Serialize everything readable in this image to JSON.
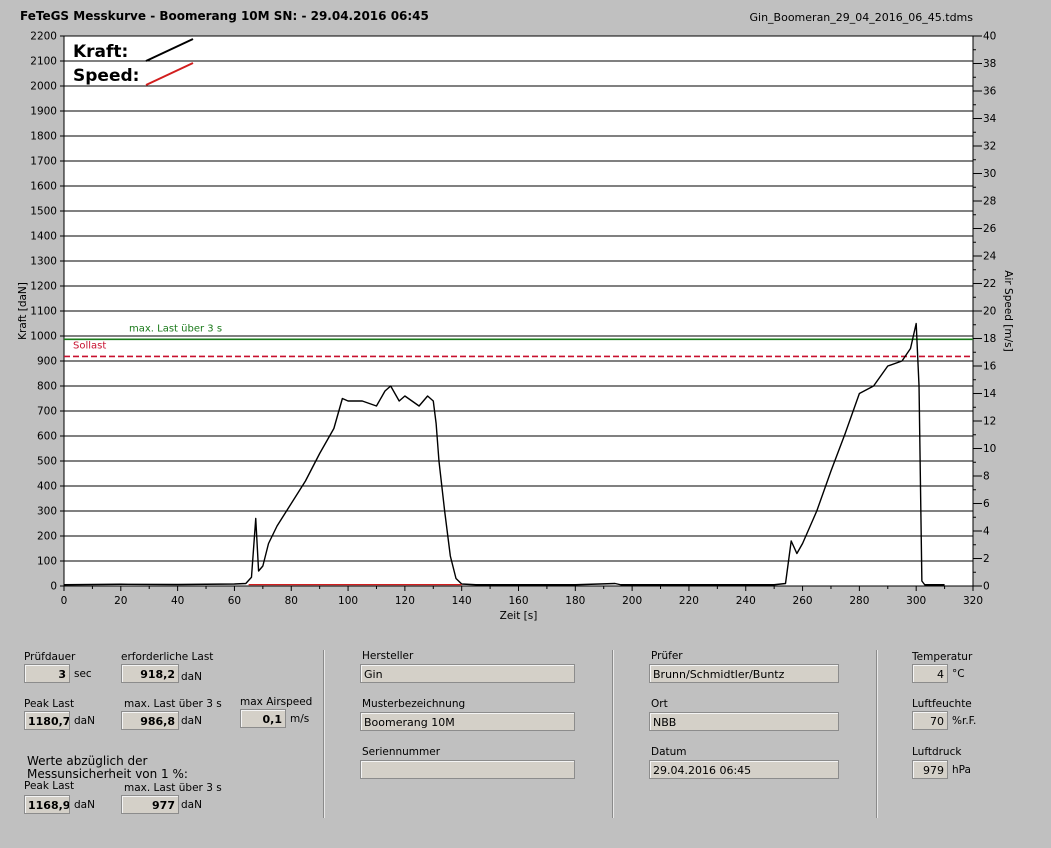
{
  "header": {
    "title": "FeTeGS Messkurve - Boomerang 10M  SN:  - 29.04.2016 06:45",
    "filename": "Gin_Boomeran_29_04_2016_06_45.tdms"
  },
  "chart_data": {
    "type": "line",
    "xlabel": "Zeit [s]",
    "ylabel": "Kraft [daN]",
    "y2label": "Air Speed [m/s]",
    "xlim": [
      0,
      320
    ],
    "ylim": [
      0,
      2200
    ],
    "y2lim": [
      0,
      40
    ],
    "xticks": [
      0,
      20,
      40,
      60,
      80,
      100,
      120,
      140,
      160,
      180,
      200,
      220,
      240,
      260,
      280,
      300,
      320
    ],
    "yticks": [
      0,
      100,
      200,
      300,
      400,
      500,
      600,
      700,
      800,
      900,
      1000,
      1100,
      1200,
      1300,
      1400,
      1500,
      1600,
      1700,
      1800,
      1900,
      2000,
      2100,
      2200
    ],
    "y2ticks": [
      0,
      2,
      4,
      6,
      8,
      10,
      12,
      14,
      16,
      18,
      20,
      22,
      24,
      26,
      28,
      30,
      32,
      34,
      36,
      38,
      40
    ],
    "grid": "horizontal",
    "legend": [
      {
        "name": "Kraft:",
        "color": "#000000"
      },
      {
        "name": "Speed:",
        "color": "#d21e1e"
      }
    ],
    "reference_lines": [
      {
        "label": "max. Last über  3 s",
        "value": 986.8,
        "color": "#1a7a1a",
        "style": "solid"
      },
      {
        "label": "Sollast",
        "value": 918.2,
        "color": "#c8102e",
        "style": "dashed"
      }
    ],
    "series": [
      {
        "name": "Kraft:",
        "color": "#000000",
        "x": [
          0,
          20,
          40,
          60,
          64,
          66,
          67.5,
          68.5,
          70,
          72,
          75,
          80,
          85,
          90,
          95,
          98,
          100,
          105,
          110,
          113,
          115,
          118,
          120,
          125,
          128,
          130,
          131,
          132,
          134,
          136,
          138,
          140,
          145,
          160,
          180,
          194,
          196,
          220,
          250,
          254,
          256,
          258,
          260,
          265,
          270,
          275,
          280,
          285,
          290,
          295,
          298,
          300,
          301,
          302,
          303,
          305,
          310
        ],
        "y": [
          5,
          7,
          6,
          8,
          10,
          35,
          270,
          60,
          80,
          170,
          240,
          330,
          420,
          530,
          630,
          750,
          740,
          740,
          720,
          780,
          800,
          740,
          760,
          720,
          760,
          740,
          650,
          500,
          300,
          120,
          30,
          8,
          5,
          5,
          5,
          10,
          5,
          5,
          5,
          10,
          180,
          130,
          170,
          300,
          460,
          610,
          770,
          800,
          880,
          900,
          950,
          1050,
          800,
          20,
          5,
          5,
          5
        ]
      },
      {
        "name": "Speed:",
        "color": "#d21e1e",
        "x": [
          65,
          140
        ],
        "y": [
          0.1,
          0.1
        ]
      }
    ]
  },
  "panel": {
    "pruefdauer": {
      "label": "Prüfdauer",
      "value": "3",
      "unit": "sec"
    },
    "erforderliche_last": {
      "label": "erforderliche Last",
      "value": "918,2",
      "unit": "daN"
    },
    "peak_last": {
      "label": "Peak Last",
      "value": "1180,7",
      "unit": "daN"
    },
    "max_last": {
      "label": "max. Last über  3 s",
      "value": "986,8",
      "unit": "daN"
    },
    "max_airspeed": {
      "label": "max Airspeed",
      "value": "0,1",
      "unit": "m/s"
    },
    "note": {
      "line1": "Werte abzüglich der",
      "line2": "Messunsicherheit von 1  %:"
    },
    "peak_last2": {
      "label": "Peak Last",
      "value": "1168,9",
      "unit": "daN"
    },
    "max_last2": {
      "label": "max. Last über  3 s",
      "value": "977",
      "unit": "daN"
    },
    "hersteller": {
      "label": "Hersteller",
      "value": "Gin"
    },
    "musterbezeichnung": {
      "label": "Musterbezeichnung",
      "value": "Boomerang 10M"
    },
    "seriennummer": {
      "label": "Seriennummer",
      "value": ""
    },
    "pruefer": {
      "label": "Prüfer",
      "value": "Brunn/Schmidtler/Buntz"
    },
    "ort": {
      "label": "Ort",
      "value": "NBB"
    },
    "datum": {
      "label": "Datum",
      "value": "29.04.2016 06:45"
    },
    "temperatur": {
      "label": "Temperatur",
      "value": "4",
      "unit": "°C"
    },
    "luftfeuchte": {
      "label": "Luftfeuchte",
      "value": "70",
      "unit": "%r.F."
    },
    "luftdruck": {
      "label": "Luftdruck",
      "value": "979",
      "unit": "hPa"
    }
  }
}
